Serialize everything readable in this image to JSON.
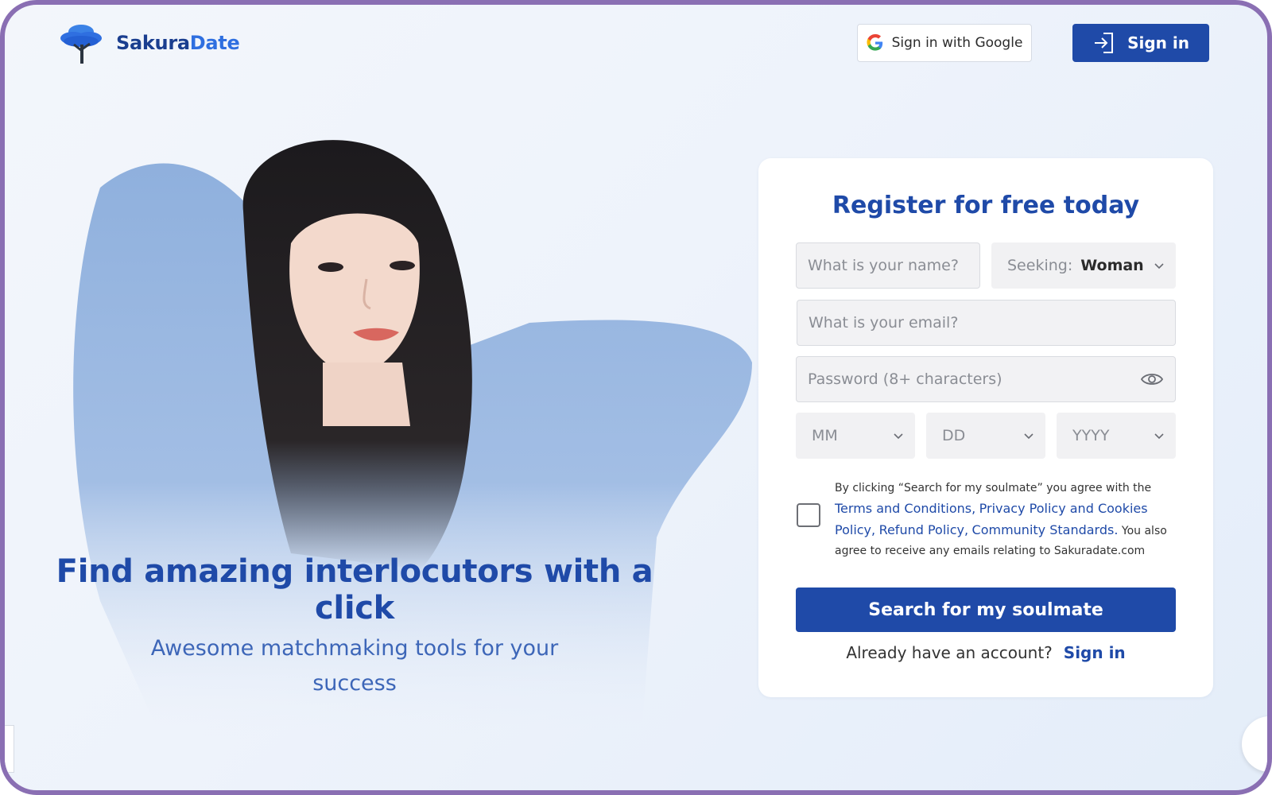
{
  "header": {
    "brand": {
      "part1": "Sakura",
      "part2": "Date"
    },
    "google_label": "Sign in with Google",
    "signin_label": "Sign in"
  },
  "hero": {
    "headline": "Find amazing interlocutors with a click",
    "subline": "Awesome matchmaking tools for your success"
  },
  "form": {
    "title": "Register for free today",
    "name_placeholder": "What is your name?",
    "seeking_label": "Seeking:",
    "seeking_value": "Woman",
    "email_placeholder": "What is your email?",
    "password_placeholder": "Password (8+ characters)",
    "dob": {
      "month": "MM",
      "day": "DD",
      "year": "YYYY"
    },
    "terms": {
      "prefix": "By clicking “Search for my soulmate” you agree with the ",
      "link1": "Terms and Conditions,",
      "link2": "Privacy Policy and Cookies Policy,",
      "link3": "Refund Policy,",
      "link4": "Community Standards.",
      "suffix": " You also agree to receive any emails relating to Sakuradate.com"
    },
    "submit_label": "Search for my soulmate",
    "already_text": "Already have an account?",
    "signin_link": "Sign in"
  },
  "colors": {
    "brand_blue": "#1f4aa8",
    "accent_blue": "#2f6fe0",
    "frame_purple": "#8a6fb3"
  }
}
